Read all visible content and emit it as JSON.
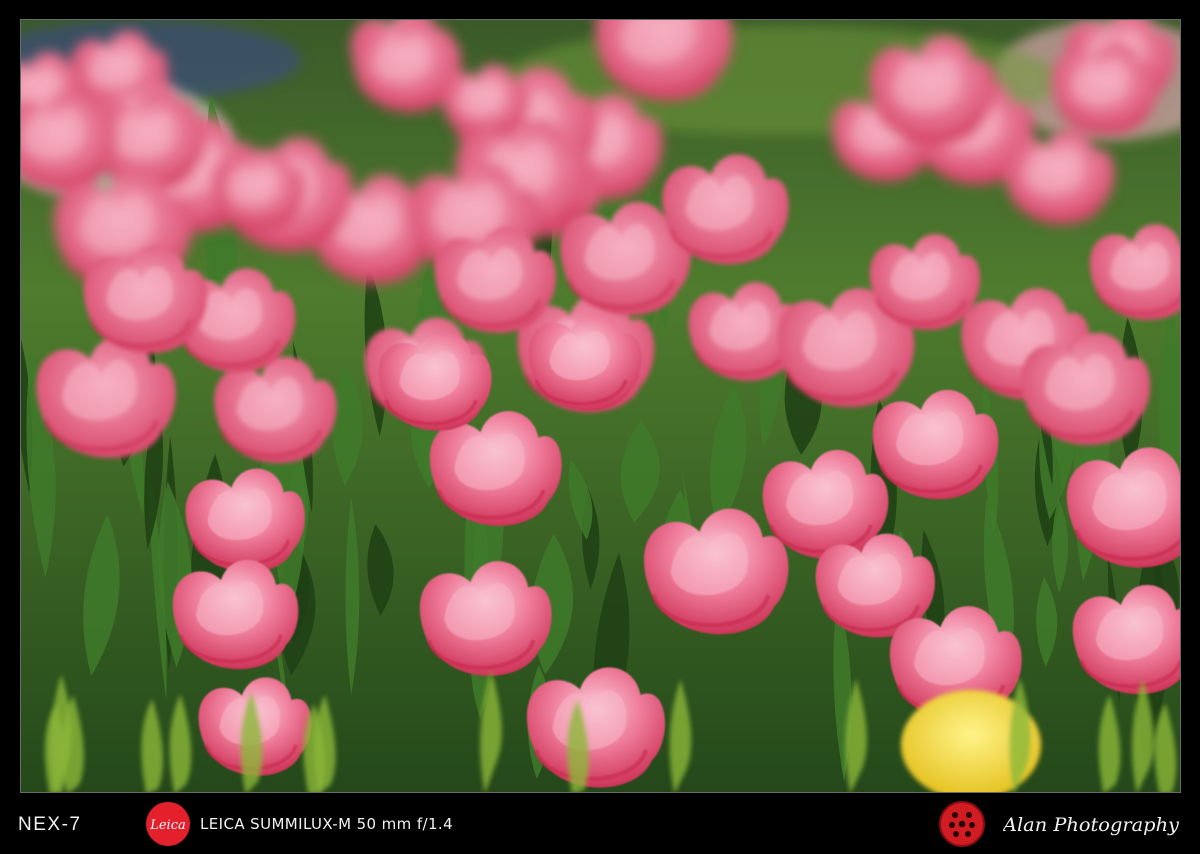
{
  "photo": {
    "subject": "flower-field",
    "colors": {
      "petal_pink": "#e85a80",
      "petal_light": "#f7b8c8",
      "petal_deep": "#c8284c",
      "leaf": "#3f7a2a",
      "leaf_dark": "#1e3f14",
      "yellow": "#f0d21c"
    }
  },
  "footer": {
    "camera_model": "NEX-7",
    "brand_logo_text": "Leica",
    "lens_info": "LEICA SUMMILUX-M 50 mm f/1.4",
    "signature": "Alan Photography",
    "colors": {
      "text": "#f2f2f2",
      "logo_red": "#e4202c"
    }
  }
}
